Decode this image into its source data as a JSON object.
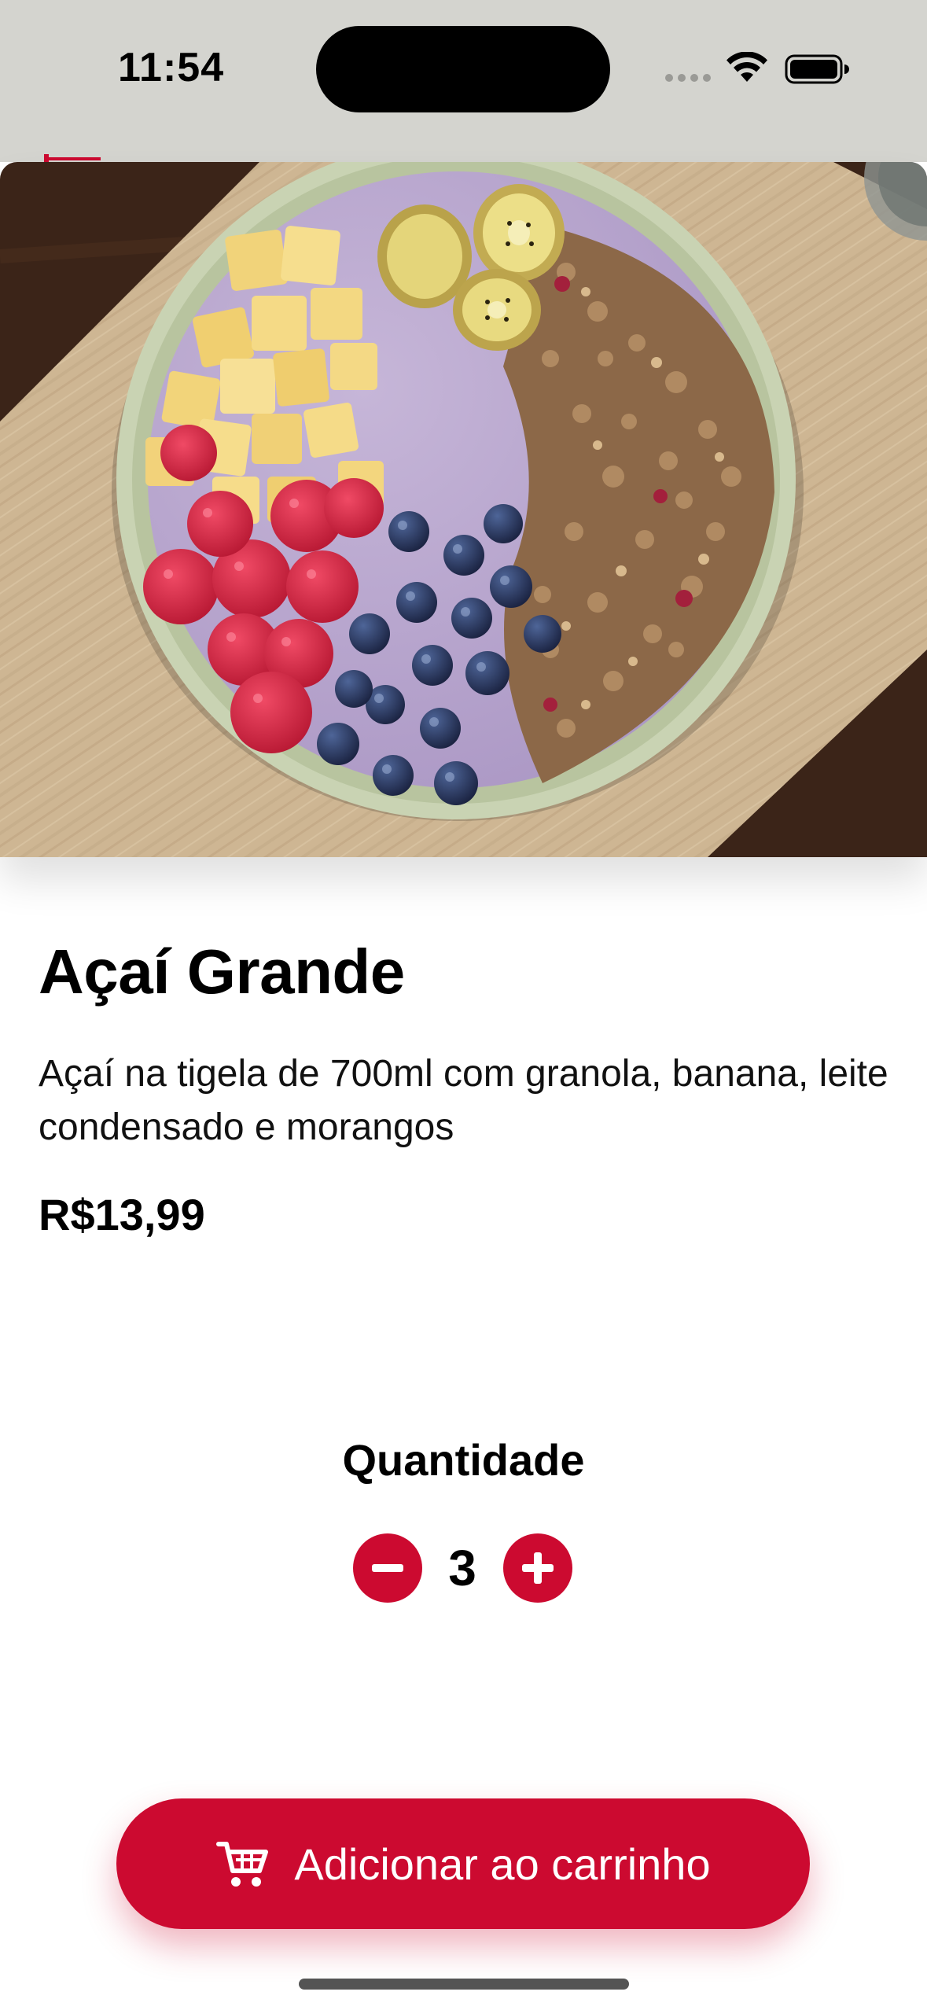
{
  "status_bar": {
    "time": "11:54",
    "icons": [
      "signal-dots-icon",
      "wifi-icon",
      "battery-icon"
    ]
  },
  "hero": {
    "image": "acai-bowl-photo"
  },
  "product": {
    "title": "Açaí Grande",
    "description": "Açaí na tigela de 700ml com granola, banana, leite condensado e morangos",
    "price": "R$13,99"
  },
  "quantity": {
    "label": "Quantidade",
    "value": "3",
    "decrement_icon": "minus-icon",
    "increment_icon": "plus-icon"
  },
  "cart_button": {
    "label": "Adicionar ao carrinho",
    "icon": "cart-icon"
  },
  "colors": {
    "accent": "#cc0a30",
    "status_bar_bg": "#d4d4cf",
    "background": "#ffffff"
  }
}
